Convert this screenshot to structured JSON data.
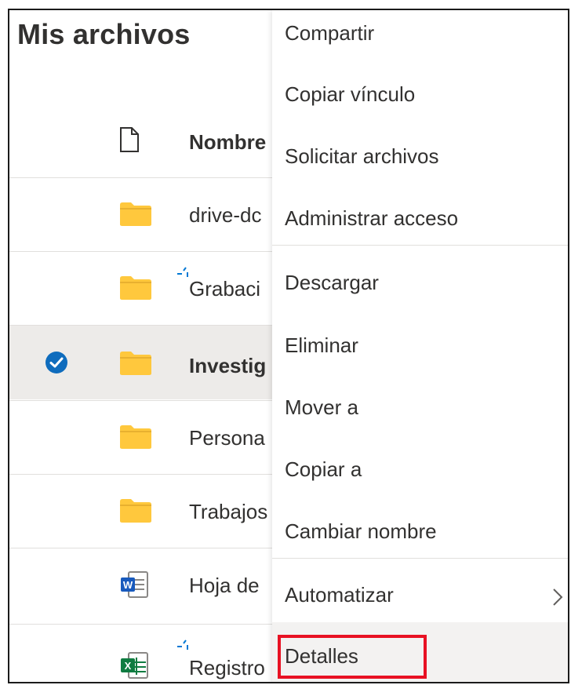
{
  "page": {
    "title": "Mis archivos"
  },
  "list": {
    "column_name": "Nombre",
    "rows": [
      {
        "name": "drive-dc",
        "type": "folder",
        "selected": false,
        "syncing": false
      },
      {
        "name": "Grabaci",
        "type": "folder",
        "selected": false,
        "syncing": true
      },
      {
        "name": "Investig",
        "type": "folder",
        "selected": true,
        "syncing": false
      },
      {
        "name": "Persona",
        "type": "folder",
        "selected": false,
        "syncing": false
      },
      {
        "name": "Trabajos",
        "type": "folder",
        "selected": false,
        "syncing": false
      },
      {
        "name": "Hoja de",
        "type": "word",
        "selected": false,
        "syncing": false
      },
      {
        "name": "Registro",
        "type": "excel",
        "selected": false,
        "syncing": true
      }
    ]
  },
  "context_menu": {
    "items": [
      {
        "label": "Compartir"
      },
      {
        "label": "Copiar vínculo"
      },
      {
        "label": "Solicitar archivos"
      },
      {
        "label": "Administrar acceso"
      },
      {
        "label": "Descargar"
      },
      {
        "label": "Eliminar"
      },
      {
        "label": "Mover a"
      },
      {
        "label": "Copiar a"
      },
      {
        "label": "Cambiar nombre"
      },
      {
        "label": "Automatizar",
        "has_submenu": true
      },
      {
        "label": "Detalles",
        "highlighted": true
      }
    ]
  },
  "colors": {
    "folder": "#ffc83d",
    "folder_dark": "#e8b02f",
    "check_blue": "#0f6cbd",
    "sync_blue": "#0078d4",
    "highlight_red": "#e81123",
    "word_blue": "#185abd",
    "excel_green": "#107c41"
  },
  "icons": {
    "file": "document-icon",
    "folder": "folder-icon",
    "word": "word-file-icon",
    "excel": "excel-file-icon",
    "check": "check-circle-icon",
    "sync": "sync-sparkle-icon",
    "chevron": "chevron-right-icon"
  }
}
